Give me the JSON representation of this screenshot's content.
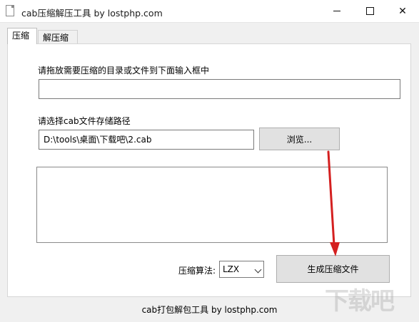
{
  "window": {
    "title": "cab压缩解压工具 by lostphp.com",
    "minimize_glyph": "",
    "maximize_glyph": "",
    "close_glyph": "✕"
  },
  "tabs": [
    {
      "label": "压缩",
      "active": true
    },
    {
      "label": "解压缩",
      "active": false
    }
  ],
  "compress": {
    "drop_label": "请拖放需要压缩的目录或文件到下面输入框中",
    "drop_input_value": "",
    "path_label": "请选择cab文件存储路径",
    "path_value": "D:\\tools\\桌面\\下载吧\\2.cab",
    "browse_label": "浏览...",
    "algorithm_label": "压缩算法:",
    "algorithm_selected": "LZX",
    "generate_label": "生成压缩文件"
  },
  "footer": {
    "text": "cab打包解包工具 by lostphp.com"
  },
  "watermark": {
    "text": "下载吧"
  },
  "colors": {
    "annotation_arrow": "#d42020",
    "button_bg": "#e1e1e1",
    "window_bg": "#f0f0f0"
  }
}
